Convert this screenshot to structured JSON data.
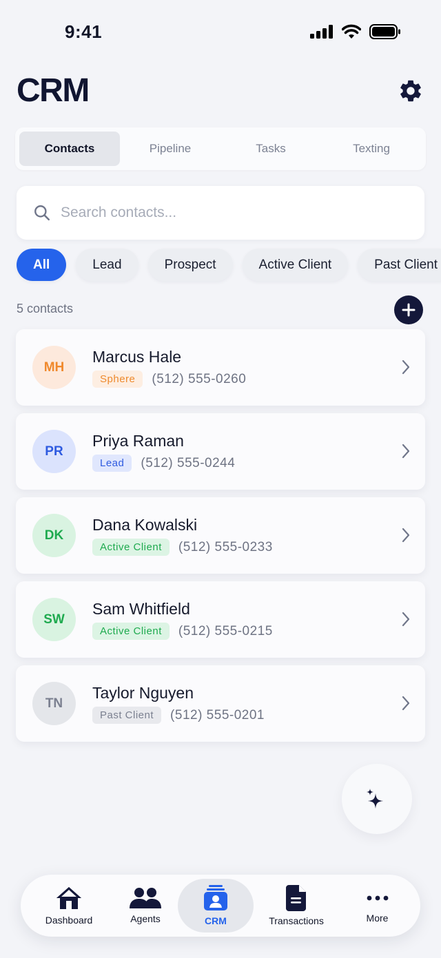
{
  "status": {
    "time": "9:41"
  },
  "header": {
    "title": "CRM"
  },
  "tabs": [
    {
      "label": "Contacts",
      "active": true
    },
    {
      "label": "Pipeline",
      "active": false
    },
    {
      "label": "Tasks",
      "active": false
    },
    {
      "label": "Texting",
      "active": false
    }
  ],
  "search": {
    "placeholder": "Search contacts...",
    "value": ""
  },
  "filters": [
    "All",
    "Lead",
    "Prospect",
    "Active Client",
    "Past Client"
  ],
  "active_filter": "All",
  "count_label": "5 contacts",
  "contacts": [
    {
      "initials": "MH",
      "name": "Marcus Hale",
      "tag": "Sphere",
      "phone": "(512) 555-0260"
    },
    {
      "initials": "PR",
      "name": "Priya Raman",
      "tag": "Lead",
      "phone": "(512) 555-0244"
    },
    {
      "initials": "DK",
      "name": "Dana Kowalski",
      "tag": "Active Client",
      "phone": "(512) 555-0233"
    },
    {
      "initials": "SW",
      "name": "Sam Whitfield",
      "tag": "Active Client",
      "phone": "(512) 555-0215"
    },
    {
      "initials": "TN",
      "name": "Taylor Nguyen",
      "tag": "Past Client",
      "phone": "(512) 555-0201"
    }
  ],
  "tag_colors": {
    "Sphere": {
      "avatar_bg": "#fde9dc",
      "avatar_fg": "#f0892c",
      "badge_bg": "#fdeee2",
      "badge_fg": "#ee8a2e"
    },
    "Lead": {
      "avatar_bg": "#dbe3fd",
      "avatar_fg": "#2f5be0",
      "badge_bg": "#e0e7fd",
      "badge_fg": "#2f5be0"
    },
    "Active Client": {
      "avatar_bg": "#d9f3e1",
      "avatar_fg": "#1faa4f",
      "badge_bg": "#dcf4e4",
      "badge_fg": "#1faa4f"
    },
    "Past Client": {
      "avatar_bg": "#e4e6ea",
      "avatar_fg": "#7b8090",
      "badge_bg": "#e8e9ed",
      "badge_fg": "#7b8090"
    }
  },
  "nav": [
    {
      "label": "Dashboard",
      "icon": "home-icon",
      "active": false
    },
    {
      "label": "Agents",
      "icon": "people-icon",
      "active": false
    },
    {
      "label": "CRM",
      "icon": "contact-card-icon",
      "active": true
    },
    {
      "label": "Transactions",
      "icon": "document-icon",
      "active": false
    },
    {
      "label": "More",
      "icon": "more-dots-icon",
      "active": false
    }
  ],
  "colors": {
    "accent": "#2563eb",
    "navy": "#14183a",
    "background": "#f3f4f8"
  }
}
